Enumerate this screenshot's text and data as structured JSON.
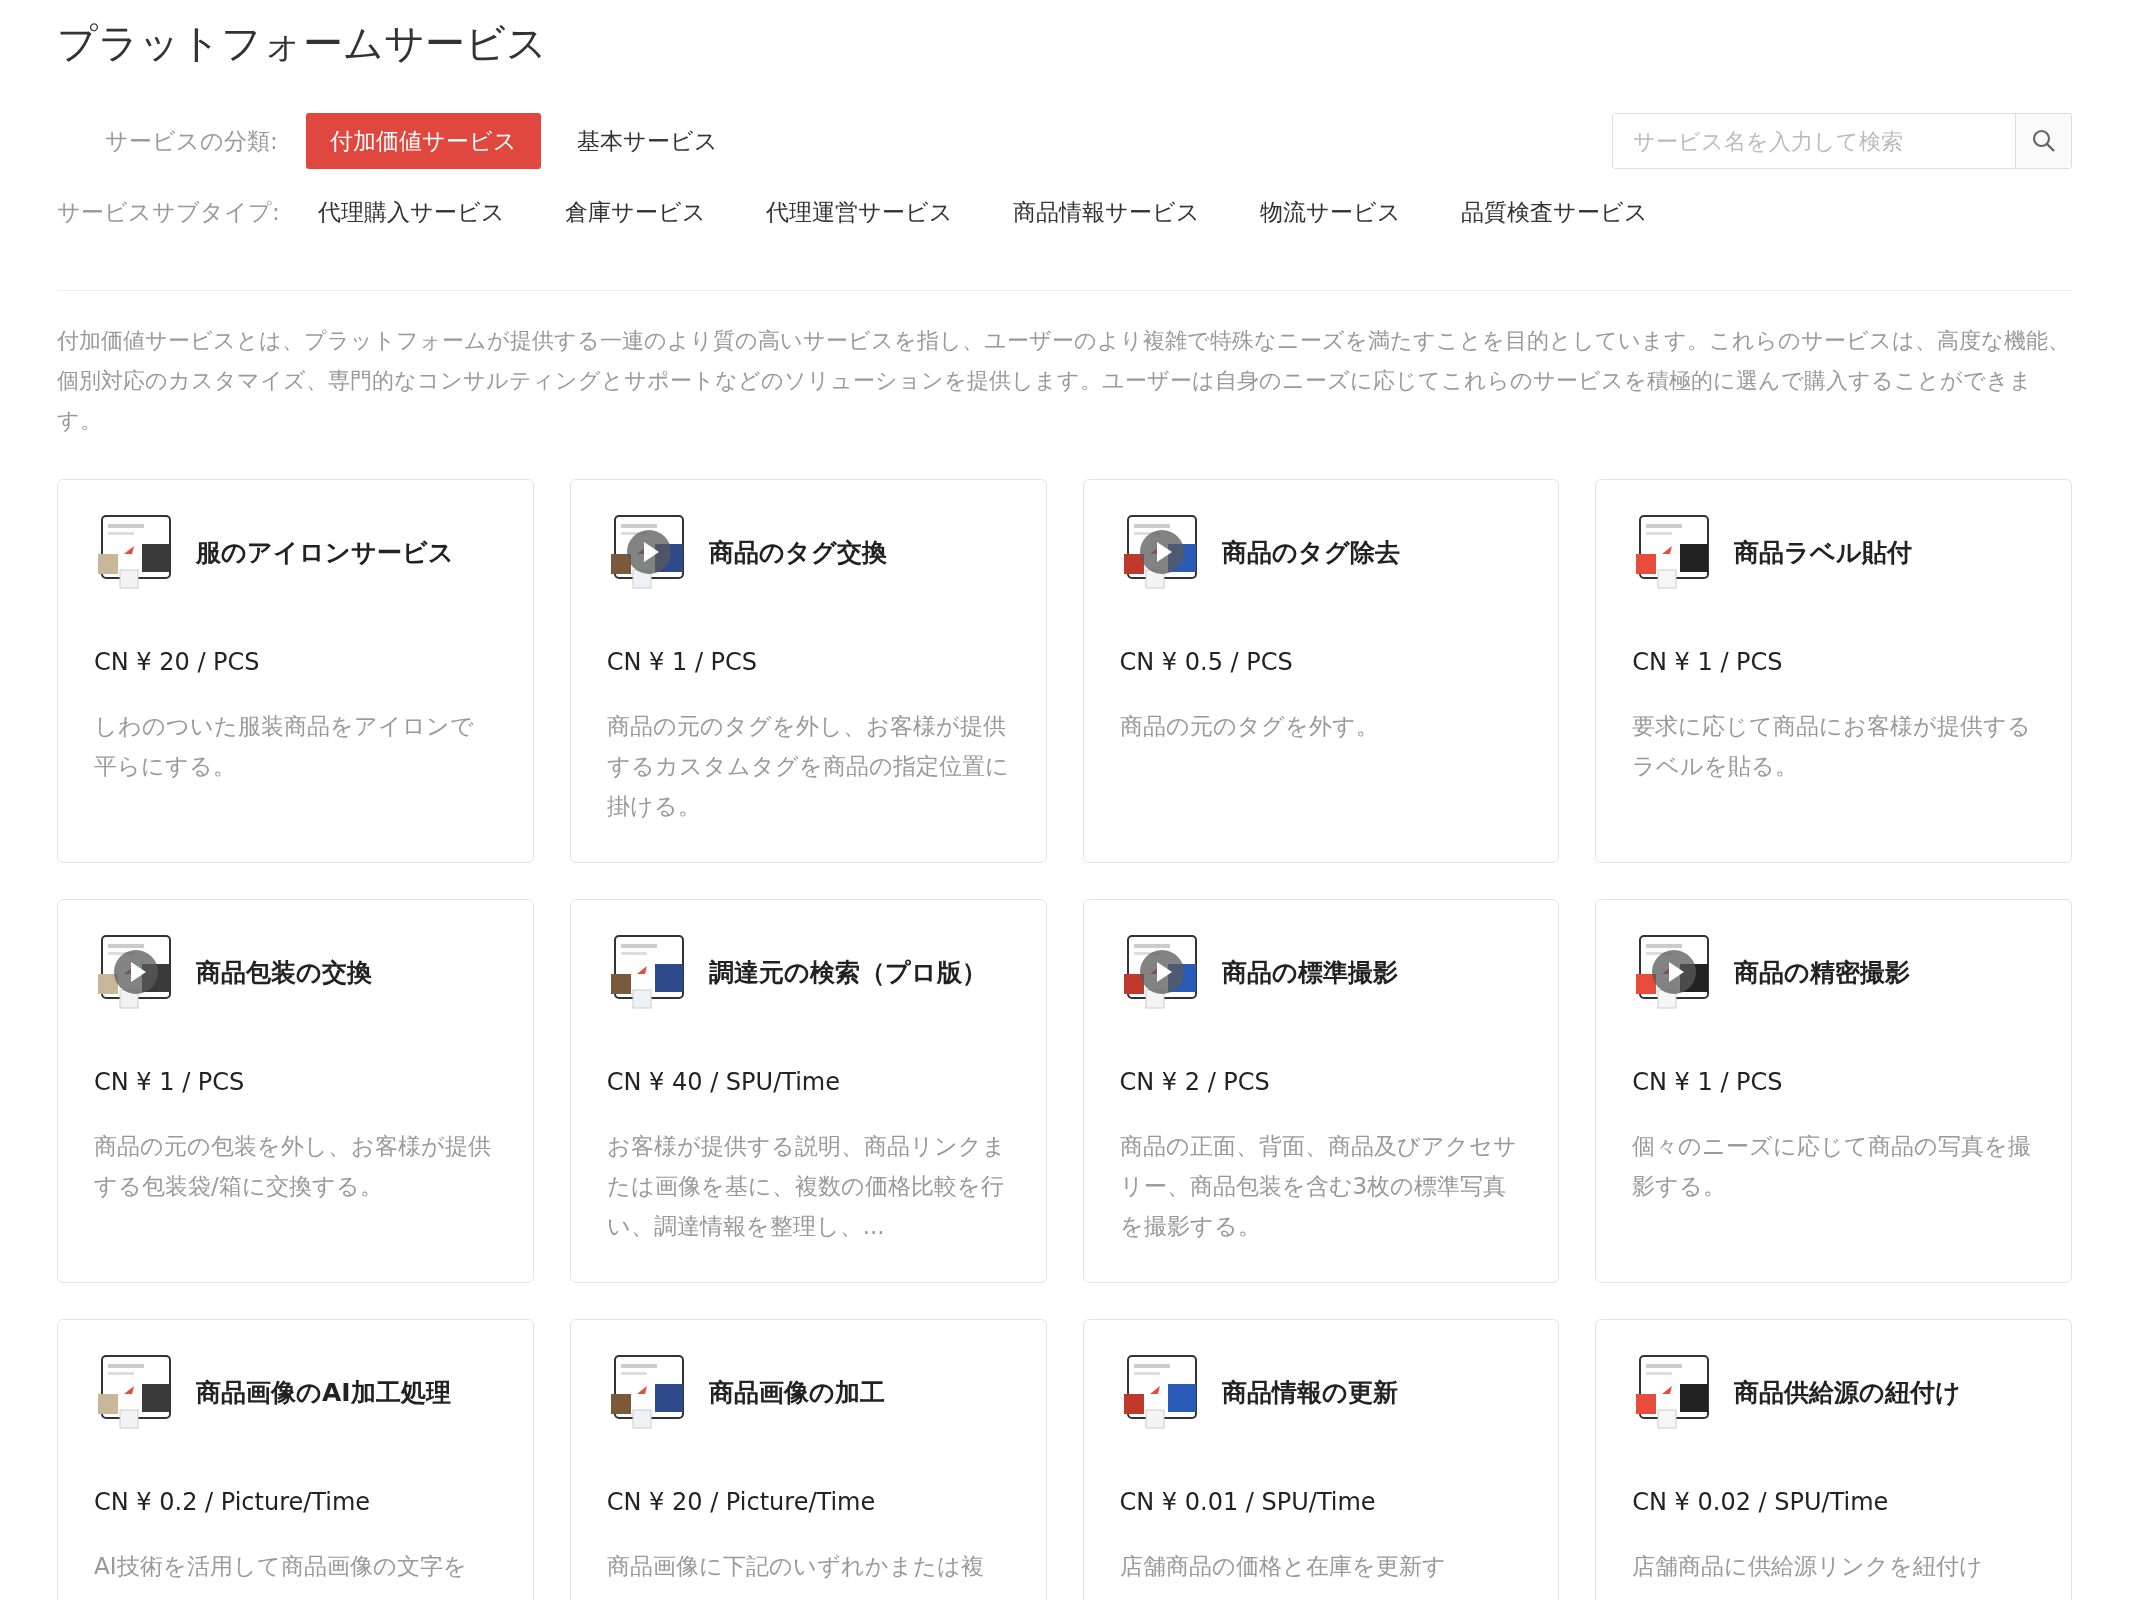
{
  "page_title": "プラットフォームサービス",
  "category": {
    "label": "サービスの分類:",
    "options": [
      {
        "label": "付加価値サービス",
        "selected": true
      },
      {
        "label": "基本サービス",
        "selected": false
      }
    ]
  },
  "search": {
    "placeholder": "サービス名を入力して検索"
  },
  "subtype": {
    "label": "サービスサブタイプ:",
    "options": [
      {
        "label": "代理購入サービス",
        "selected": false
      },
      {
        "label": "倉庫サービス",
        "selected": false
      },
      {
        "label": "代理運営サービス",
        "selected": false
      },
      {
        "label": "商品情報サービス",
        "selected": false
      },
      {
        "label": "物流サービス",
        "selected": false
      },
      {
        "label": "品質検査サービス",
        "selected": false
      }
    ]
  },
  "description": "付加価値サービスとは、プラットフォームが提供する一連のより質の高いサービスを指し、ユーザーのより複雑で特殊なニーズを満たすことを目的としています。これらのサービスは、高度な機能、個別対応のカスタマイズ、専門的なコンサルティングとサポートなどのソリューションを提供します。ユーザーは自身のニーズに応じてこれらのサービスを積極的に選んで購入することができます。",
  "services": [
    {
      "title": "服のアイロンサービス",
      "price": "CN ¥ 20 / PCS",
      "text": "しわのついた服装商品をアイロンで平らにする。",
      "video": false
    },
    {
      "title": "商品のタグ交換",
      "price": "CN ¥ 1 / PCS",
      "text": "商品の元のタグを外し、お客様が提供するカスタムタグを商品の指定位置に掛ける。",
      "video": true
    },
    {
      "title": "商品のタグ除去",
      "price": "CN ¥ 0.5 / PCS",
      "text": "商品の元のタグを外す。",
      "video": true
    },
    {
      "title": "商品ラベル貼付",
      "price": "CN ¥ 1 / PCS",
      "text": "要求に応じて商品にお客様が提供するラベルを貼る。",
      "video": false
    },
    {
      "title": "商品包装の交換",
      "price": "CN ¥ 1 / PCS",
      "text": "商品の元の包装を外し、お客様が提供する包装袋/箱に交換する。",
      "video": true
    },
    {
      "title": "調達元の検索（プロ版）",
      "price": "CN ¥ 40 / SPU/Time",
      "text": "お客様が提供する説明、商品リンクまたは画像を基に、複数の価格比較を行い、調達情報を整理し、...",
      "video": false
    },
    {
      "title": "商品の標準撮影",
      "price": "CN ¥ 2 / PCS",
      "text": "商品の正面、背面、商品及びアクセサリー、商品包装を含む3枚の標準写真を撮影する。",
      "video": true
    },
    {
      "title": "商品の精密撮影",
      "price": "CN ¥ 1 / PCS",
      "text": "個々のニーズに応じて商品の写真を撮影する。",
      "video": true
    },
    {
      "title": "商品画像のAI加工処理",
      "price": "CN ¥ 0.2 / Picture/Time",
      "text": "AI技術を活用して商品画像の文字を",
      "video": false
    },
    {
      "title": "商品画像の加工",
      "price": "CN ¥ 20 / Picture/Time",
      "text": "商品画像に下記のいずれかまたは複",
      "video": false
    },
    {
      "title": "商品情報の更新",
      "price": "CN ¥ 0.01 / SPU/Time",
      "text": "店舗商品の価格と在庫を更新す",
      "video": false
    },
    {
      "title": "商品供給源の紐付け",
      "price": "CN ¥ 0.02 / SPU/Time",
      "text": "店舗商品に供給源リンクを紐付け",
      "video": false
    }
  ]
}
